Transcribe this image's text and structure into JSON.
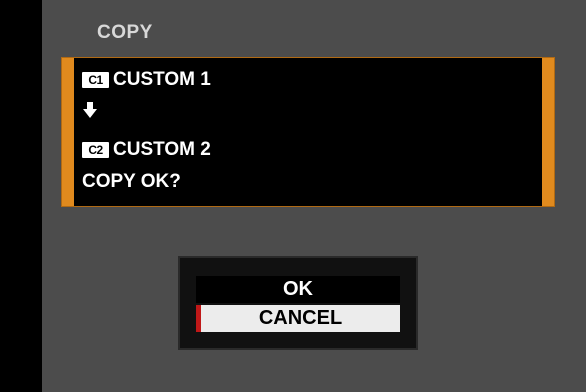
{
  "title": "COPY",
  "message": {
    "source_badge": "C1",
    "source_label": "CUSTOM 1",
    "arrow_icon": "arrow-down-icon",
    "target_badge": "C2",
    "target_label": "CUSTOM 2",
    "prompt": "COPY OK?"
  },
  "options": {
    "ok_label": "OK",
    "cancel_label": "CANCEL",
    "selected": "CANCEL"
  },
  "colors": {
    "accent": "#e08a1e",
    "selection_marker": "#c01818",
    "background": "#4c4c4c"
  }
}
